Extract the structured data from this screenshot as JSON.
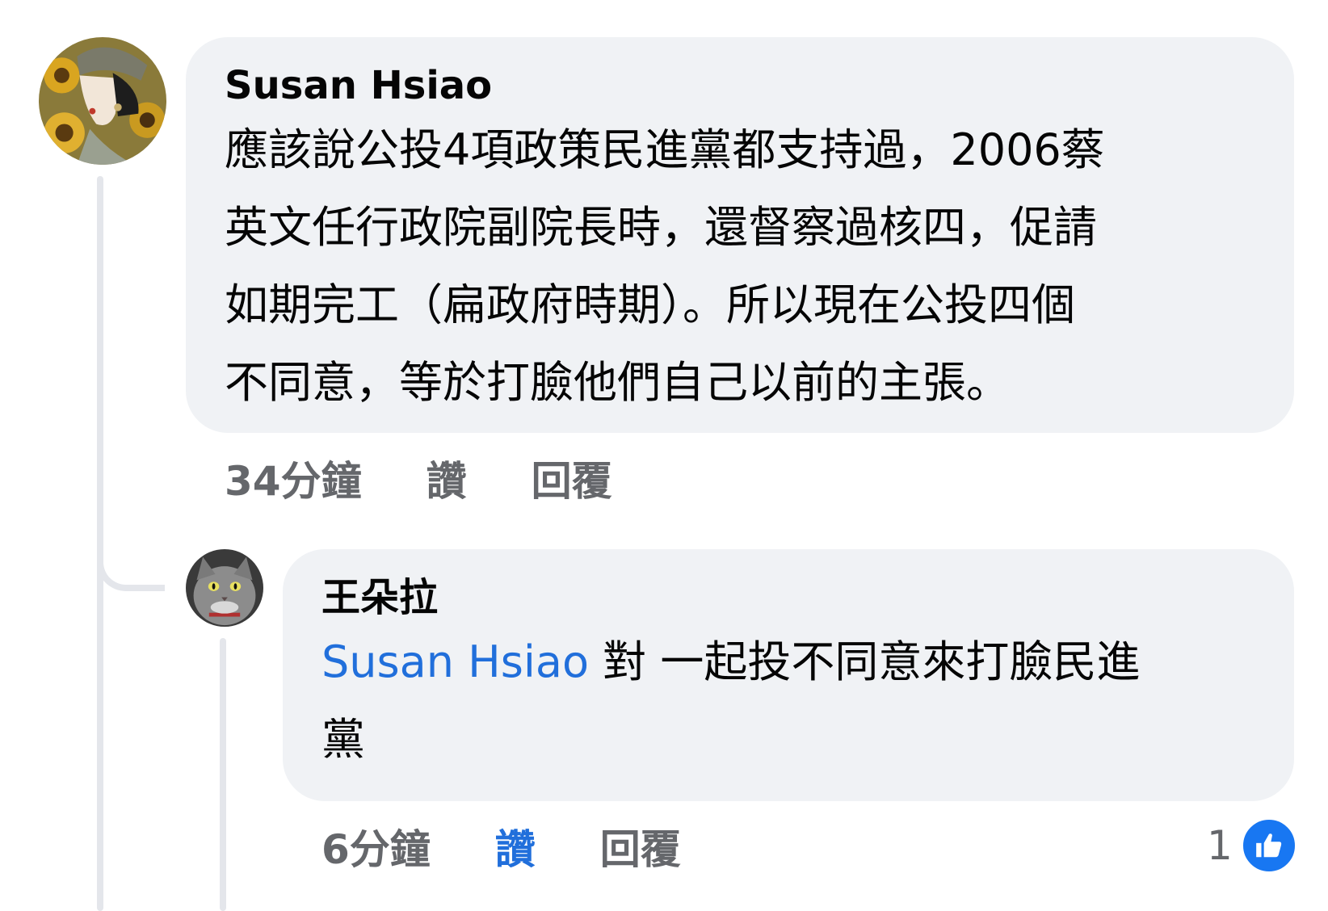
{
  "comment": {
    "author": "Susan Hsiao",
    "lines": [
      "應該說公投4項政策民進黨都支持過，2006蔡",
      "英文任行政院副院長時，還督察過核四，促請",
      "如期完工（扁政府時期）。所以現在公投四個",
      "不同意，等於打臉他們自己以前的主張。"
    ],
    "time": "34分鐘",
    "like_label": "讚",
    "reply_label": "回覆"
  },
  "reply": {
    "author": "王朵拉",
    "mention": "Susan Hsiao",
    "line1_rest": " 對 一起投不同意來打臉民進",
    "line2": "黨",
    "time": "6分鐘",
    "like_label": "讚",
    "reply_label": "回覆",
    "reaction_count": "1",
    "reaction_icon": "thumbs-up-icon"
  },
  "colors": {
    "bubble": "#f0f2f5",
    "link": "#216fdb",
    "meta": "#65676b",
    "like_badge": "#1877f2"
  }
}
